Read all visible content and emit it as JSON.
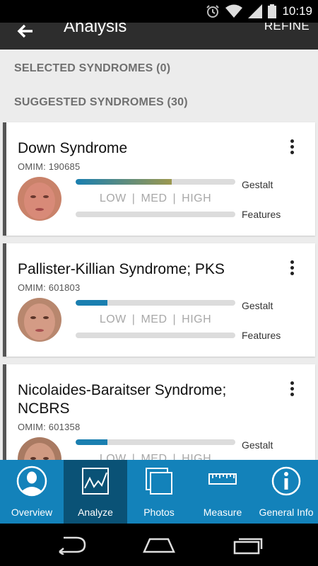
{
  "status_bar": {
    "time": "10:19",
    "icons": [
      "alarm-icon",
      "wifi-icon",
      "signal-icon",
      "battery-icon"
    ]
  },
  "app_bar": {
    "back_icon": "arrow-back-icon",
    "title": "Analysis",
    "action": "REFINE"
  },
  "sections": {
    "selected": "SELECTED SYNDROMES (0)",
    "suggested": "SUGGESTED SYNDROMES (30)"
  },
  "cards": [
    {
      "name": "Down Syndrome",
      "omim": "OMIM: 190685",
      "gestalt_fill": 0.6,
      "gestalt_label": "Gestalt",
      "features_fill": 0,
      "features_label": "Features",
      "scale": {
        "low": "LOW",
        "med": "MED",
        "high": "HIGH",
        "sep": "|"
      }
    },
    {
      "name": "Pallister-Killian Syndrome; PKS",
      "omim": "OMIM: 601803",
      "gestalt_fill": 0.2,
      "gestalt_label": "Gestalt",
      "features_fill": 0,
      "features_label": "Features",
      "scale": {
        "low": "LOW",
        "med": "MED",
        "high": "HIGH",
        "sep": "|"
      }
    },
    {
      "name": "Nicolaides-Baraitser Syndrome; NCBRS",
      "omim": "OMIM: 601358",
      "gestalt_fill": 0.2,
      "gestalt_label": "Gestalt",
      "scale": {
        "low": "LOW",
        "med": "MED",
        "high": "HIGH",
        "sep": "|"
      }
    }
  ],
  "bottom_nav": [
    {
      "label": "Overview",
      "icon": "person-icon",
      "active": false
    },
    {
      "label": "Analyze",
      "icon": "chart-icon",
      "active": true
    },
    {
      "label": "Photos",
      "icon": "photos-icon",
      "active": false
    },
    {
      "label": "Measure",
      "icon": "ruler-icon",
      "active": false
    },
    {
      "label": "General Info",
      "icon": "info-icon",
      "active": false
    }
  ],
  "colors": {
    "accent": "#1382ba",
    "active_tab": "#0a5276",
    "app_bar": "#2d2d2d",
    "bar_blue": "#1a7fb0",
    "bar_olive": "#9c9850"
  }
}
